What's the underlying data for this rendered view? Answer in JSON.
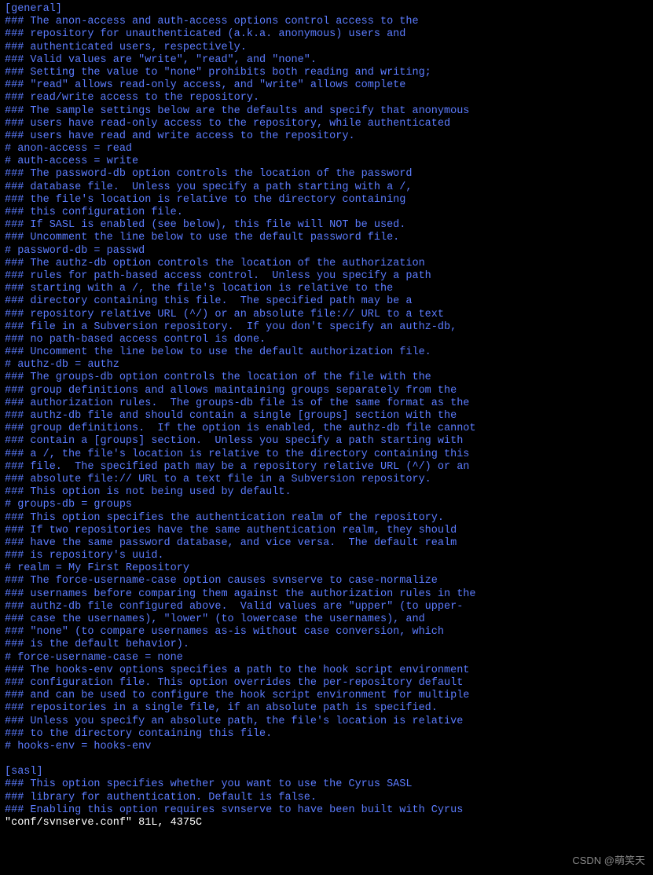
{
  "lines": [
    {
      "text": "[general]",
      "class": "special-blue"
    },
    {
      "text": "### The anon-access and auth-access options control access to the",
      "class": "special-blue"
    },
    {
      "text": "### repository for unauthenticated (a.k.a. anonymous) users and",
      "class": "special-blue"
    },
    {
      "text": "### authenticated users, respectively.",
      "class": "special-blue"
    },
    {
      "text": "### Valid values are \"write\", \"read\", and \"none\".",
      "class": "special-blue"
    },
    {
      "text": "### Setting the value to \"none\" prohibits both reading and writing;",
      "class": "special-blue"
    },
    {
      "text": "### \"read\" allows read-only access, and \"write\" allows complete",
      "class": "special-blue"
    },
    {
      "text": "### read/write access to the repository.",
      "class": "special-blue"
    },
    {
      "text": "### The sample settings below are the defaults and specify that anonymous",
      "class": "special-blue"
    },
    {
      "text": "### users have read-only access to the repository, while authenticated",
      "class": "special-blue"
    },
    {
      "text": "### users have read and write access to the repository.",
      "class": "special-blue"
    },
    {
      "text": "# anon-access = read",
      "class": "special-blue"
    },
    {
      "text": "# auth-access = write",
      "class": "special-blue"
    },
    {
      "text": "### The password-db option controls the location of the password",
      "class": "special-blue"
    },
    {
      "text": "### database file.  Unless you specify a path starting with a /,",
      "class": "special-blue"
    },
    {
      "text": "### the file's location is relative to the directory containing",
      "class": "special-blue"
    },
    {
      "text": "### this configuration file.",
      "class": "special-blue"
    },
    {
      "text": "### If SASL is enabled (see below), this file will NOT be used.",
      "class": "special-blue"
    },
    {
      "text": "### Uncomment the line below to use the default password file.",
      "class": "special-blue"
    },
    {
      "text": "# password-db = passwd",
      "class": "special-blue"
    },
    {
      "text": "### The authz-db option controls the location of the authorization",
      "class": "special-blue"
    },
    {
      "text": "### rules for path-based access control.  Unless you specify a path",
      "class": "special-blue"
    },
    {
      "text": "### starting with a /, the file's location is relative to the",
      "class": "special-blue"
    },
    {
      "text": "### directory containing this file.  The specified path may be a",
      "class": "special-blue"
    },
    {
      "text": "### repository relative URL (^/) or an absolute file:// URL to a text",
      "class": "special-blue"
    },
    {
      "text": "### file in a Subversion repository.  If you don't specify an authz-db,",
      "class": "special-blue"
    },
    {
      "text": "### no path-based access control is done.",
      "class": "special-blue"
    },
    {
      "text": "### Uncomment the line below to use the default authorization file.",
      "class": "special-blue"
    },
    {
      "text": "# authz-db = authz",
      "class": "special-blue"
    },
    {
      "text": "### The groups-db option controls the location of the file with the",
      "class": "special-blue"
    },
    {
      "text": "### group definitions and allows maintaining groups separately from the",
      "class": "special-blue"
    },
    {
      "text": "### authorization rules.  The groups-db file is of the same format as the",
      "class": "special-blue"
    },
    {
      "text": "### authz-db file and should contain a single [groups] section with the",
      "class": "special-blue"
    },
    {
      "text": "### group definitions.  If the option is enabled, the authz-db file cannot",
      "class": "special-blue"
    },
    {
      "text": "### contain a [groups] section.  Unless you specify a path starting with",
      "class": "special-blue"
    },
    {
      "text": "### a /, the file's location is relative to the directory containing this",
      "class": "special-blue"
    },
    {
      "text": "### file.  The specified path may be a repository relative URL (^/) or an",
      "class": "special-blue"
    },
    {
      "text": "### absolute file:// URL to a text file in a Subversion repository.",
      "class": "special-blue"
    },
    {
      "text": "### This option is not being used by default.",
      "class": "special-blue"
    },
    {
      "text": "# groups-db = groups",
      "class": "special-blue"
    },
    {
      "text": "### This option specifies the authentication realm of the repository.",
      "class": "special-blue"
    },
    {
      "text": "### If two repositories have the same authentication realm, they should",
      "class": "special-blue"
    },
    {
      "text": "### have the same password database, and vice versa.  The default realm",
      "class": "special-blue"
    },
    {
      "text": "### is repository's uuid.",
      "class": "special-blue"
    },
    {
      "text": "# realm = My First Repository",
      "class": "special-blue"
    },
    {
      "text": "### The force-username-case option causes svnserve to case-normalize",
      "class": "special-blue"
    },
    {
      "text": "### usernames before comparing them against the authorization rules in the",
      "class": "special-blue"
    },
    {
      "text": "### authz-db file configured above.  Valid values are \"upper\" (to upper-",
      "class": "special-blue"
    },
    {
      "text": "### case the usernames), \"lower\" (to lowercase the usernames), and",
      "class": "special-blue"
    },
    {
      "text": "### \"none\" (to compare usernames as-is without case conversion, which",
      "class": "special-blue"
    },
    {
      "text": "### is the default behavior).",
      "class": "special-blue"
    },
    {
      "text": "# force-username-case = none",
      "class": "special-blue"
    },
    {
      "text": "### The hooks-env options specifies a path to the hook script environment",
      "class": "special-blue"
    },
    {
      "text": "### configuration file. This option overrides the per-repository default",
      "class": "special-blue"
    },
    {
      "text": "### and can be used to configure the hook script environment for multiple",
      "class": "special-blue"
    },
    {
      "text": "### repositories in a single file, if an absolute path is specified.",
      "class": "special-blue"
    },
    {
      "text": "### Unless you specify an absolute path, the file's location is relative",
      "class": "special-blue"
    },
    {
      "text": "### to the directory containing this file.",
      "class": "special-blue"
    },
    {
      "text": "# hooks-env = hooks-env",
      "class": "special-blue"
    },
    {
      "text": "",
      "class": ""
    },
    {
      "text": "[sasl]",
      "class": "special-blue"
    },
    {
      "text": "### This option specifies whether you want to use the Cyrus SASL",
      "class": "special-blue"
    },
    {
      "text": "### library for authentication. Default is false.",
      "class": "special-blue"
    },
    {
      "text": "### Enabling this option requires svnserve to have been built with Cyrus",
      "class": "special-blue"
    },
    {
      "text": "\"conf/svnserve.conf\" 81L, 4375C",
      "class": ""
    }
  ],
  "watermark": "CSDN @萌笑天"
}
